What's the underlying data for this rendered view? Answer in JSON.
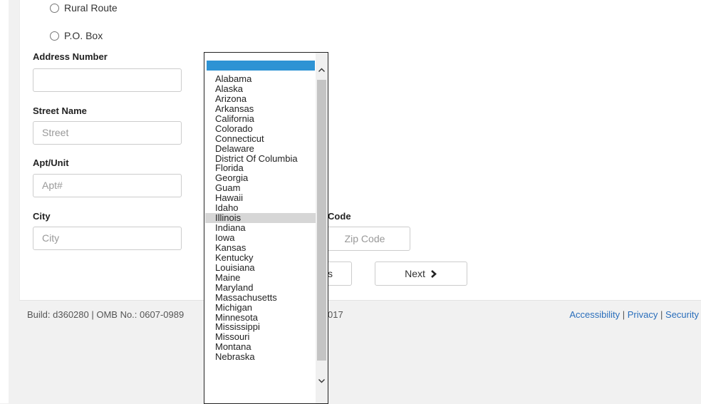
{
  "form": {
    "radio_options": [
      "Rural Route",
      "P.O. Box"
    ],
    "address_number": {
      "label": "Address Number",
      "value": ""
    },
    "street_name": {
      "label": "Street Name",
      "placeholder": "Street"
    },
    "apt_unit": {
      "label": "Apt/Unit",
      "placeholder": "Apt#"
    },
    "city": {
      "label": "City",
      "placeholder": "City"
    },
    "zip": {
      "label_visible": "P Code",
      "placeholder": "Zip Code"
    },
    "prev_button_visible": "s",
    "next_button": "Next"
  },
  "state_dropdown": {
    "selected": "",
    "hovered": "Illinois",
    "options": [
      "Alabama",
      "Alaska",
      "Arizona",
      "Arkansas",
      "California",
      "Colorado",
      "Connecticut",
      "Delaware",
      "District Of Columbia",
      "Florida",
      "Georgia",
      "Guam",
      "Hawaii",
      "Idaho",
      "Illinois",
      "Indiana",
      "Iowa",
      "Kansas",
      "Kentucky",
      "Louisiana",
      "Maine",
      "Maryland",
      "Massachusetts",
      "Michigan",
      "Minnesota",
      "Mississippi",
      "Missouri",
      "Montana",
      "Nebraska"
    ]
  },
  "footer": {
    "build_left": "Build: d360280  |  OMB No.: 0607-0989",
    "build_right": "017",
    "links": [
      "Accessibility",
      "Privacy",
      "Security"
    ],
    "separator": "|"
  },
  "colors": {
    "selected_option": "#2e93d4",
    "link": "#2a6ebb"
  }
}
